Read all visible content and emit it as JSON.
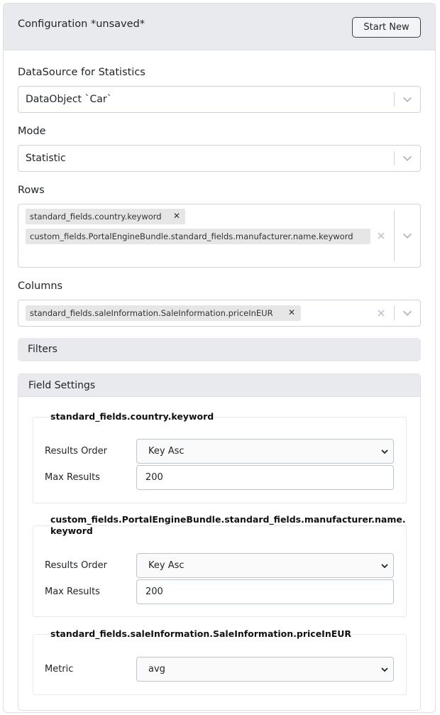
{
  "header": {
    "title": "Configuration *unsaved*",
    "start_new_label": "Start New"
  },
  "datasource": {
    "label": "DataSource for Statistics",
    "value": "DataObject `Car`"
  },
  "mode": {
    "label": "Mode",
    "value": "Statistic"
  },
  "rows": {
    "label": "Rows",
    "tags": [
      "standard_fields.country.keyword",
      "custom_fields.PortalEngineBundle.standard_fields.manufacturer.name.keyword"
    ]
  },
  "columns": {
    "label": "Columns",
    "tags": [
      "standard_fields.saleInformation.SaleInformation.priceInEUR"
    ]
  },
  "filters": {
    "label": "Filters"
  },
  "field_settings": {
    "label": "Field Settings",
    "groups": [
      {
        "title": "standard_fields.country.keyword",
        "results_order_label": "Results Order",
        "results_order_value": "Key Asc",
        "max_results_label": "Max Results",
        "max_results_value": "200"
      },
      {
        "title_line1": "custom_fields.PortalEngineBundle.standard_fields.manufacturer.name.",
        "title_line2": "keyword",
        "results_order_label": "Results Order",
        "results_order_value": "Key Asc",
        "max_results_label": "Max Results",
        "max_results_value": "200"
      },
      {
        "title": "standard_fields.saleInformation.SaleInformation.priceInEUR",
        "metric_label": "Metric",
        "metric_value": "avg"
      }
    ]
  },
  "icons": {
    "chevron": "chevron-down-icon",
    "clear": "clear-x-icon",
    "tag_remove": "tag-remove-icon"
  },
  "colors": {
    "header_bg": "#e8eaee",
    "border": "#cfd3d8",
    "tag_bg": "#e6e6e6"
  }
}
